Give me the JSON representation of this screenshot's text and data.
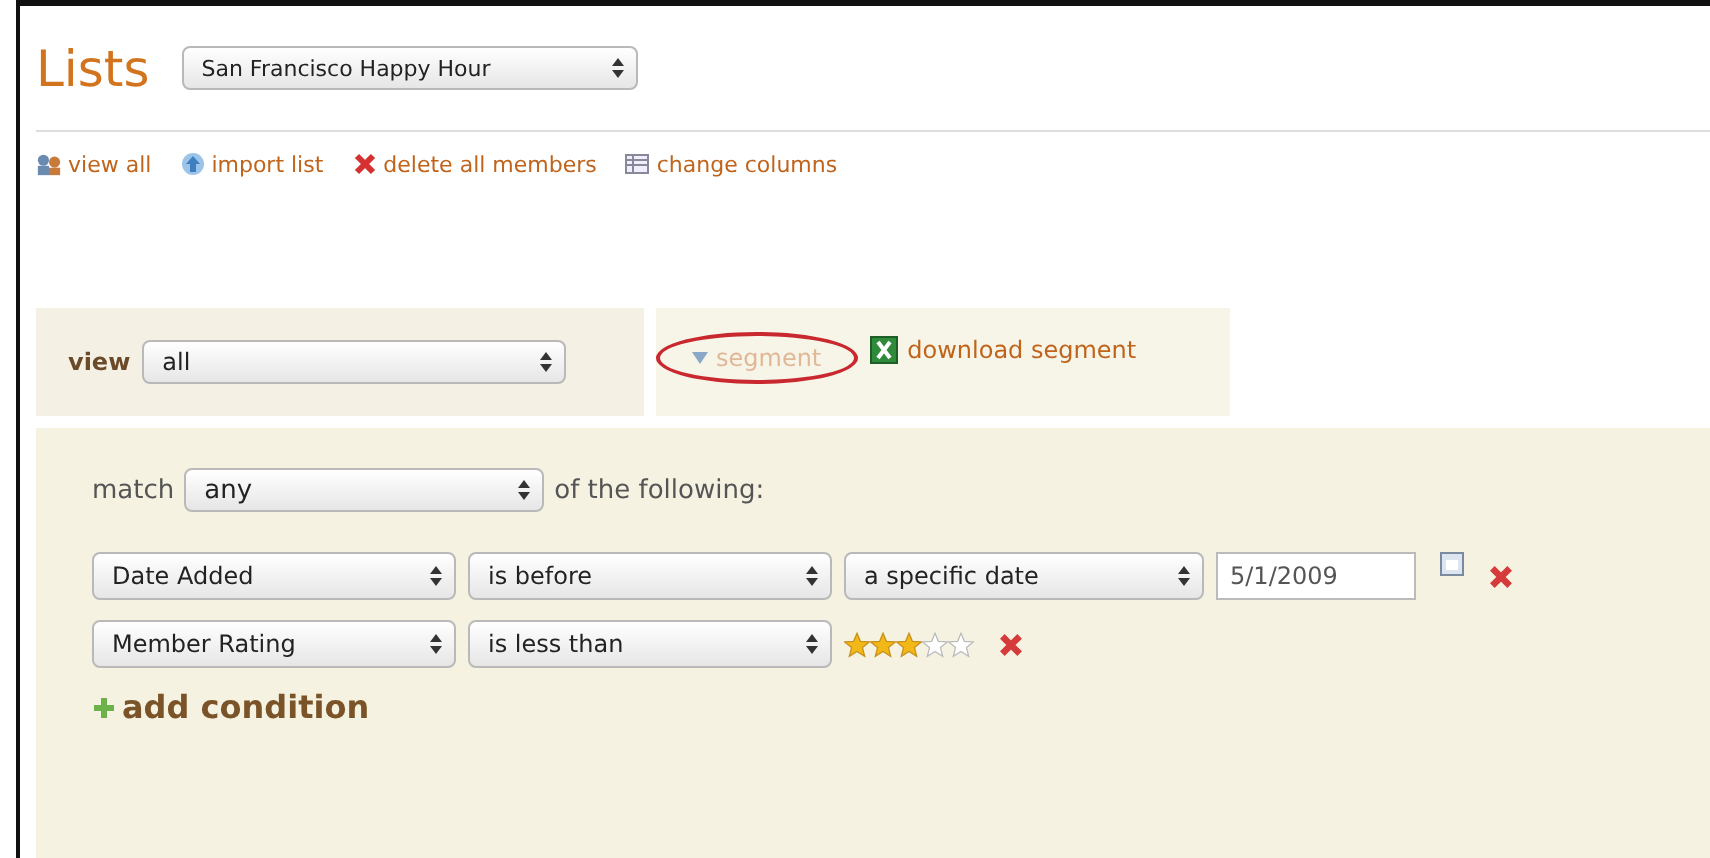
{
  "title": "Lists",
  "list_select": {
    "value": "San Francisco Happy Hour"
  },
  "actions": [
    {
      "label": "view all",
      "kind": "people"
    },
    {
      "label": "import list",
      "kind": "upload"
    },
    {
      "label": "delete all members",
      "kind": "delete"
    },
    {
      "label": "change columns",
      "kind": "columns"
    }
  ],
  "view": {
    "label": "view",
    "value": "all"
  },
  "segment": {
    "label": "segment",
    "expanded": true,
    "highlighted": true
  },
  "download": {
    "label": "download segment"
  },
  "match": {
    "label": "match",
    "value": "any",
    "suffix": "of the following:"
  },
  "conditions": [
    {
      "parts": [
        {
          "kind": "select",
          "value": "Date Added"
        },
        {
          "kind": "select",
          "value": "is before"
        },
        {
          "kind": "select",
          "value": "a specific date"
        },
        {
          "kind": "date",
          "value": "5/1/2009"
        }
      ]
    },
    {
      "parts": [
        {
          "kind": "select",
          "value": "Member Rating"
        },
        {
          "kind": "select",
          "value": "is less than"
        },
        {
          "kind": "stars",
          "stars": 3
        }
      ]
    }
  ],
  "add_condition": {
    "label": "add condition"
  }
}
